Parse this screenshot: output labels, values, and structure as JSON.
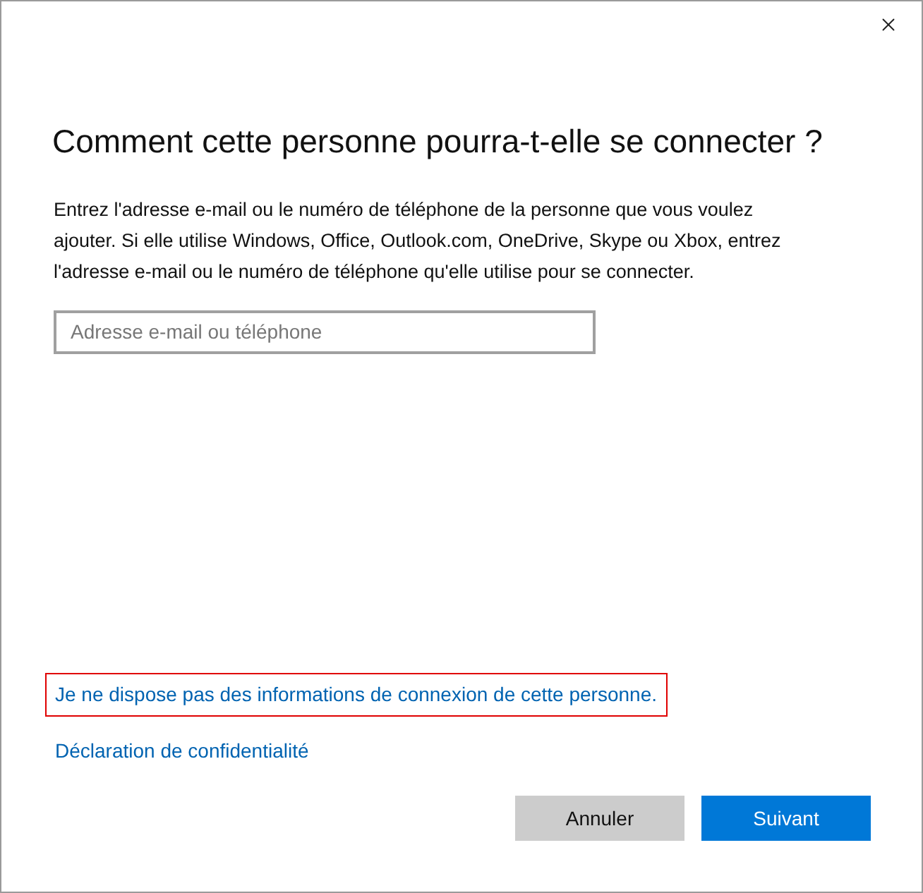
{
  "dialog": {
    "heading": "Comment cette personne pourra-t-elle se connecter ?",
    "description": "Entrez l'adresse e-mail ou le numéro de téléphone de la personne que vous voulez ajouter. Si elle utilise Windows, Office, Outlook.com, OneDrive, Skype ou Xbox, entrez l'adresse e-mail ou le numéro de téléphone qu'elle utilise pour se connecter.",
    "field": {
      "placeholder": "Adresse e-mail ou téléphone"
    },
    "links": [
      {
        "label": "Je ne dispose pas des informations de connexion de cette personne.",
        "highlighted": true
      },
      {
        "label": "Déclaration de confidentialité",
        "highlighted": false
      }
    ],
    "buttons": [
      {
        "label": "Annuler",
        "kind": "secondary"
      },
      {
        "label": "Suivant",
        "kind": "primary"
      }
    ]
  }
}
